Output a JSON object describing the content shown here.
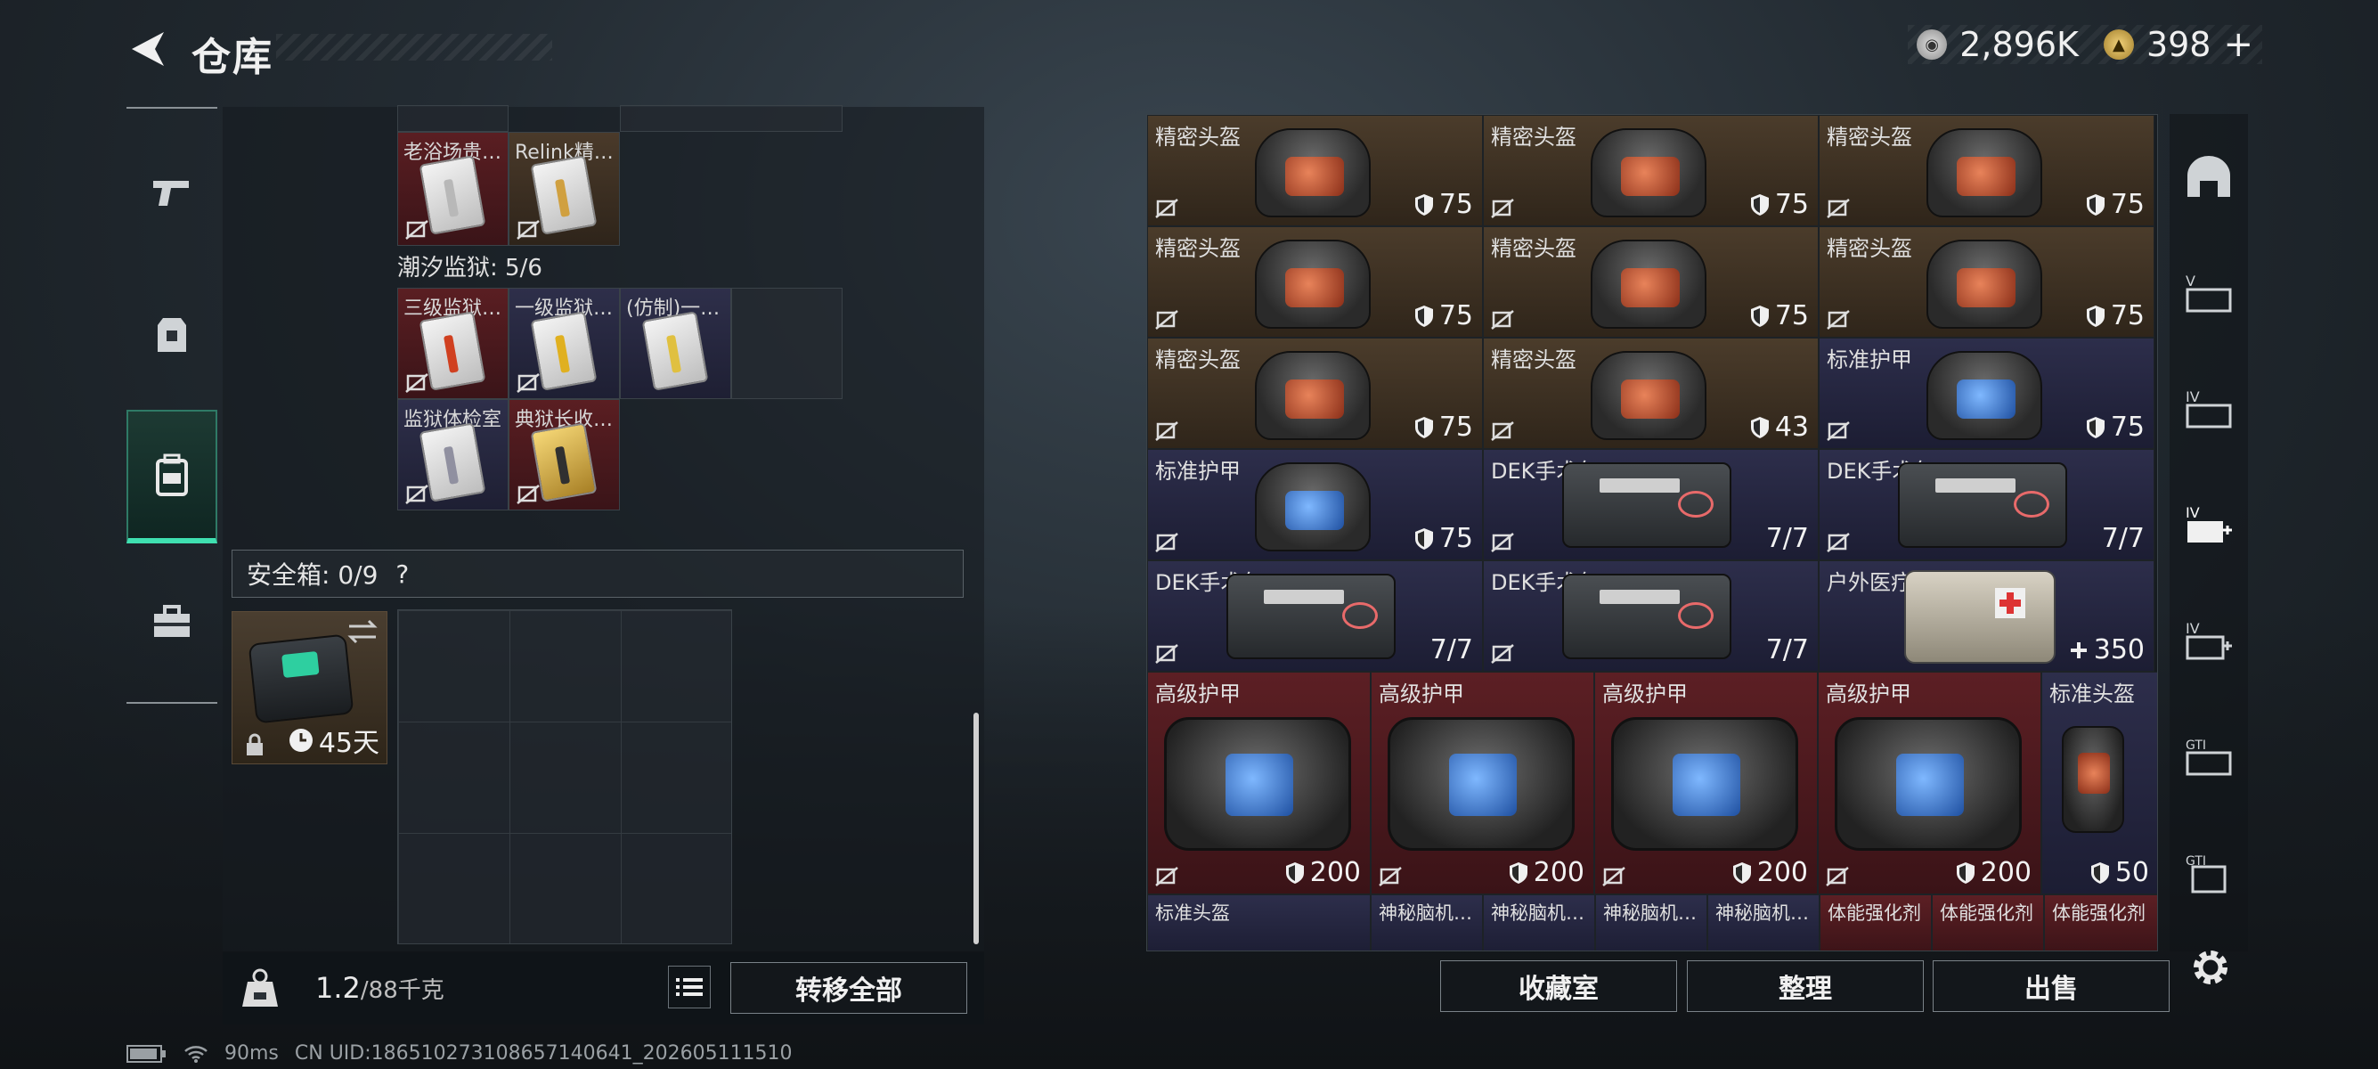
{
  "header": {
    "title": "仓库"
  },
  "currency": {
    "silver": "2,896K",
    "gold": "398",
    "add": "+"
  },
  "left": {
    "top_row": [
      {
        "label": "老浴场贵…",
        "color": "red",
        "card": "silver",
        "stripe": "#b8b8b8"
      },
      {
        "label": "Relink精…",
        "color": "brown",
        "card": "silver",
        "stripe": "#d0a040"
      }
    ],
    "section_label": "潮汐监狱: 5/6",
    "prison_row1": [
      {
        "label": "三级监狱…",
        "color": "red",
        "card": "silver",
        "stripe": "#d04020"
      },
      {
        "label": "一级监狱…",
        "color": "navy",
        "card": "silver",
        "stripe": "#e0b020"
      },
      {
        "label": "(仿制)一…",
        "color": "navy",
        "card": "silver",
        "stripe": "#e0c040"
      }
    ],
    "prison_row2": [
      {
        "label": "监狱体检室",
        "color": "navy",
        "card": "silver",
        "stripe": "#9090a0"
      },
      {
        "label": "典狱长收…",
        "color": "red",
        "card": "gold",
        "stripe": "#303030"
      }
    ],
    "safebox": {
      "label": "安全箱: 0/9",
      "help": "?",
      "duration": "45天"
    },
    "weight": {
      "current": "1.2",
      "max": "/88千克"
    },
    "transfer_all": "转移全部"
  },
  "right": {
    "items": [
      {
        "label": "精密头盔",
        "value": "75",
        "kind": "helmet",
        "color": "brown",
        "face": "red",
        "stat": "shield"
      },
      {
        "label": "精密头盔",
        "value": "75",
        "kind": "helmet",
        "color": "brown",
        "face": "red",
        "stat": "shield"
      },
      {
        "label": "精密头盔",
        "value": "75",
        "kind": "helmet",
        "color": "brown",
        "face": "red",
        "stat": "shield"
      },
      {
        "label": "精密头盔",
        "value": "75",
        "kind": "helmet",
        "color": "brown",
        "face": "red",
        "stat": "shield"
      },
      {
        "label": "精密头盔",
        "value": "75",
        "kind": "helmet",
        "color": "brown",
        "face": "red",
        "stat": "shield"
      },
      {
        "label": "精密头盔",
        "value": "75",
        "kind": "helmet",
        "color": "brown",
        "face": "red",
        "stat": "shield"
      },
      {
        "label": "精密头盔",
        "value": "75",
        "kind": "helmet",
        "color": "brown",
        "face": "red",
        "stat": "shield"
      },
      {
        "label": "精密头盔",
        "value": "43",
        "kind": "helmet",
        "color": "brown",
        "face": "red",
        "stat": "shield"
      },
      {
        "label": "标准护甲",
        "value": "75",
        "kind": "helmet",
        "color": "navy",
        "face": "blue",
        "stat": "shield"
      },
      {
        "label": "标准护甲",
        "value": "75",
        "kind": "helmet",
        "color": "navy",
        "face": "blue",
        "stat": "shield"
      },
      {
        "label": "DEK手术包",
        "value": "7/7",
        "kind": "medkit",
        "color": "navy",
        "stat": "none"
      },
      {
        "label": "DEK手术包",
        "value": "7/7",
        "kind": "medkit",
        "color": "navy",
        "stat": "none"
      },
      {
        "label": "DEK手术包",
        "value": "7/7",
        "kind": "medkit",
        "color": "navy",
        "stat": "none"
      },
      {
        "label": "DEK手术包",
        "value": "7/7",
        "kind": "medkit",
        "color": "navy",
        "stat": "none"
      },
      {
        "label": "户外医疗箱",
        "value": "350",
        "kind": "pack",
        "color": "navy",
        "stat": "plus"
      }
    ],
    "big_items": [
      {
        "label": "高级护甲",
        "value": "200"
      },
      {
        "label": "高级护甲",
        "value": "200"
      },
      {
        "label": "高级护甲",
        "value": "200"
      },
      {
        "label": "高级护甲",
        "value": "200"
      }
    ],
    "side_item": {
      "label": "标准头盔",
      "value": "50"
    },
    "bottom_row": [
      "标准头盔",
      "神秘脑机…",
      "神秘脑机…",
      "神秘脑机…",
      "神秘脑机…",
      "体能强化剂",
      "体能强化剂",
      "体能强化剂"
    ],
    "buttons": {
      "collection": "收藏室",
      "organize": "整理",
      "sell": "出售"
    }
  },
  "status": {
    "ping": "90ms",
    "uid": "CN UID:18651027310865714064​1_202605111510"
  }
}
